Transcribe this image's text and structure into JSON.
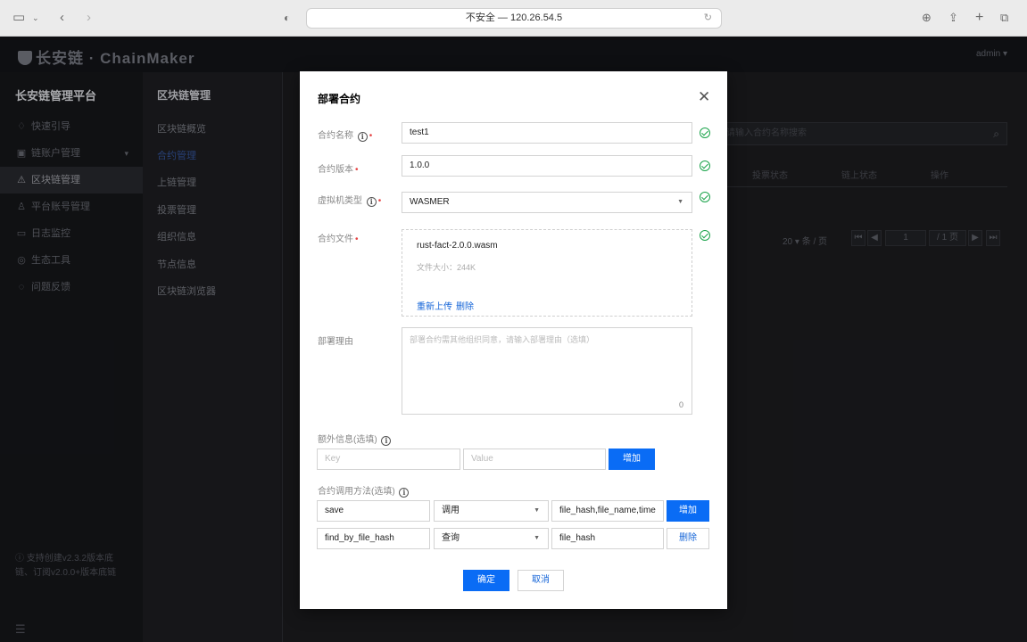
{
  "browser": {
    "url": "不安全 — 120.26.54.5",
    "icons": [
      "sidebar-icon",
      "chevron-down-icon",
      "back-icon",
      "forward-icon",
      "shield-icon",
      "reload-icon",
      "download-icon",
      "share-icon",
      "new-tab-icon",
      "tabs-icon"
    ]
  },
  "header": {
    "logo": "长安链 · ChainMaker",
    "user": "admin ▾"
  },
  "sidebar": {
    "title": "长安链管理平台",
    "items": [
      {
        "label": "快速引导",
        "icon": "♢"
      },
      {
        "label": "链账户管理",
        "icon": "▣"
      },
      {
        "label": "区块链管理",
        "icon": "⚠"
      },
      {
        "label": "平台账号管理",
        "icon": "♙"
      },
      {
        "label": "日志监控",
        "icon": "▭"
      },
      {
        "label": "生态工具",
        "icon": "◎"
      },
      {
        "label": "问题反馈",
        "icon": "◌"
      }
    ],
    "version_note": "支持创建v2.3.2版本底链、订阅v2.0.0+版本底链",
    "collapse_icon": "☰"
  },
  "subnav": {
    "title": "区块链管理",
    "items": [
      "区块链概览",
      "合约管理",
      "上链管理",
      "投票管理",
      "组织信息",
      "节点信息",
      "区块链浏览器"
    ]
  },
  "background": {
    "search_placeholder": "请输入合约名称搜索",
    "columns": [
      "投票状态",
      "链上状态",
      "操作"
    ],
    "pager_text": "20 ▾  条 / 页",
    "page_input": "1",
    "page_total": "/ 1 页",
    "nav_first": "⏮",
    "nav_prev": "◀",
    "nav_next": "▶",
    "nav_last": "⏭"
  },
  "modal": {
    "title": "部署合约",
    "close": "✕",
    "fields": {
      "name_label": "合约名称",
      "name_value": "test1",
      "version_label": "合约版本",
      "version_value": "1.0.0",
      "vm_label": "虚拟机类型",
      "vm_value": "WASMER",
      "file_label": "合约文件",
      "file_name": "rust-fact-2.0.0.wasm",
      "file_size": "文件大小：244K",
      "reupload": "重新上传",
      "delete": "删除",
      "reason_label": "部署理由",
      "reason_placeholder": "部署合约需其他组织同意，请输入部署理由（选填）",
      "reason_count": "0"
    },
    "extra": {
      "label": "额外信息(选填)",
      "key_placeholder": "Key",
      "value_placeholder": "Value",
      "add_button": "增加"
    },
    "methods": {
      "label": "合约调用方法(选填)",
      "rows": [
        {
          "name": "save",
          "type": "调用",
          "params": "file_hash,file_name,time",
          "action": "增加"
        },
        {
          "name": "find_by_file_hash",
          "type": "查询",
          "params": "file_hash",
          "action": "删除"
        }
      ]
    },
    "confirm": "确定",
    "cancel": "取消"
  }
}
